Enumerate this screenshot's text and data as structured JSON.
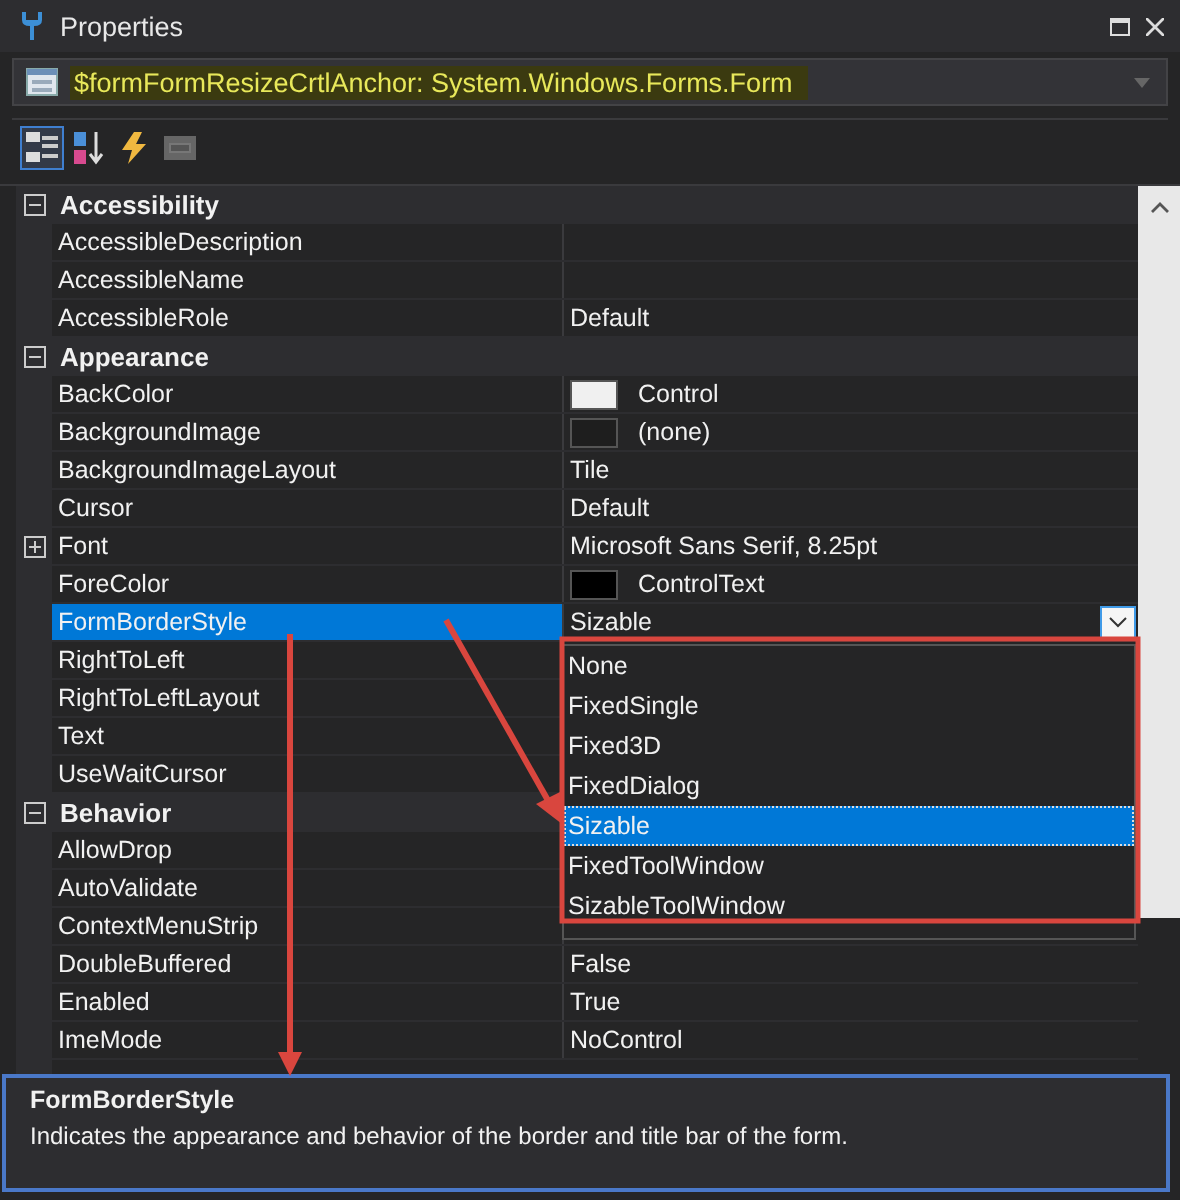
{
  "window": {
    "title": "Properties"
  },
  "object_selector": {
    "text": "$formFormResizeCrtlAnchor: System.Windows.Forms.Form"
  },
  "toolbar": [
    {
      "kind": "categorized",
      "selected": true
    },
    {
      "kind": "alphabetical",
      "selected": false
    },
    {
      "kind": "events",
      "selected": false
    },
    {
      "kind": "pages",
      "selected": false
    }
  ],
  "categories": [
    {
      "name": "Accessibility",
      "expanded": true,
      "properties": [
        {
          "name": "AccessibleDescription",
          "selected": false
        },
        {
          "name": "AccessibleName",
          "selected": false
        },
        {
          "name": "AccessibleRole",
          "value": "Default",
          "selected": false
        }
      ]
    },
    {
      "name": "Appearance",
      "expanded": true,
      "properties": [
        {
          "name": "BackColor",
          "value": "Control",
          "color": "#f0f0f0",
          "selected": false
        },
        {
          "name": "BackgroundImage",
          "value": "(none)",
          "color": "#1e1e1e",
          "selected": false
        },
        {
          "name": "BackgroundImageLayout",
          "value": "Tile",
          "selected": false
        },
        {
          "name": "Cursor",
          "value": "Default",
          "selected": false
        },
        {
          "name": "Font",
          "value": "Microsoft Sans Serif, 8.25pt",
          "expandable": true,
          "selected": false
        },
        {
          "name": "ForeColor",
          "value": "ControlText",
          "color": "#000000",
          "selected": false
        },
        {
          "name": "FormBorderStyle",
          "value": "Sizable",
          "selected": true
        },
        {
          "name": "RightToLeft",
          "selected": false
        },
        {
          "name": "RightToLeftLayout",
          "selected": false
        },
        {
          "name": "Text",
          "selected": false
        },
        {
          "name": "UseWaitCursor",
          "selected": false
        }
      ]
    },
    {
      "name": "Behavior",
      "expanded": true,
      "properties": [
        {
          "name": "AllowDrop",
          "selected": false
        },
        {
          "name": "AutoValidate",
          "selected": false
        },
        {
          "name": "ContextMenuStrip",
          "selected": false
        },
        {
          "name": "DoubleBuffered",
          "value": "False",
          "selected": false
        },
        {
          "name": "Enabled",
          "value": "True",
          "selected": false
        },
        {
          "name": "ImeMode",
          "value": "NoControl",
          "selected": false
        }
      ]
    }
  ],
  "dropdown": {
    "options": [
      {
        "label": "None",
        "selected": false
      },
      {
        "label": "FixedSingle",
        "selected": false
      },
      {
        "label": "Fixed3D",
        "selected": false
      },
      {
        "label": "FixedDialog",
        "selected": false
      },
      {
        "label": "Sizable",
        "selected": true
      },
      {
        "label": "FixedToolWindow",
        "selected": false
      },
      {
        "label": "SizableToolWindow",
        "selected": false
      }
    ]
  },
  "description": {
    "title": "FormBorderStyle",
    "text": "Indicates the appearance and behavior of the border and title bar of the form."
  }
}
